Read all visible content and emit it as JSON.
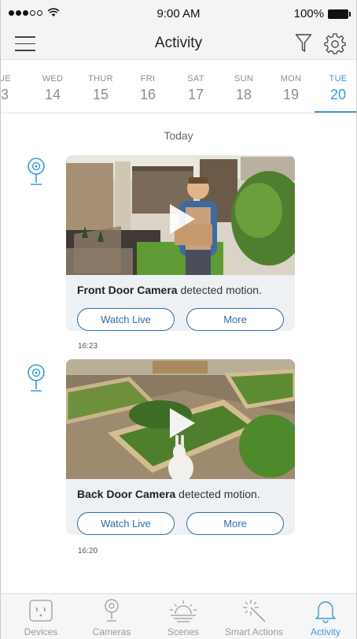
{
  "status_bar": {
    "time": "9:00 AM",
    "battery": "100%"
  },
  "navbar": {
    "title": "Activity"
  },
  "date_strip": {
    "days": [
      {
        "name": "UE",
        "date": "3"
      },
      {
        "name": "WED",
        "date": "14"
      },
      {
        "name": "THUR",
        "date": "15"
      },
      {
        "name": "FRI",
        "date": "16"
      },
      {
        "name": "SAT",
        "date": "17"
      },
      {
        "name": "SUN",
        "date": "18"
      },
      {
        "name": "MON",
        "date": "19"
      },
      {
        "name": "TUE",
        "date": "20"
      }
    ],
    "selected": "TUE 20"
  },
  "feed": {
    "section_label": "Today",
    "events": [
      {
        "camera": "Front Door Camera",
        "message": " detected motion.",
        "watch_label": "Watch Live",
        "more_label": "More",
        "time": "16:23"
      },
      {
        "camera": "Back Door Camera",
        "message": " detected motion.",
        "watch_label": "Watch Live",
        "more_label": "More",
        "time": "16:20"
      }
    ]
  },
  "tab_bar": {
    "tabs": [
      {
        "label": "Devices"
      },
      {
        "label": "Cameras"
      },
      {
        "label": "Scenes"
      },
      {
        "label": "Smart Actions"
      },
      {
        "label": "Activity"
      }
    ],
    "active": "Activity"
  },
  "colors": {
    "accent": "#3a9ad9",
    "button": "#2f6ea3",
    "card_bg": "#eef1f4"
  }
}
